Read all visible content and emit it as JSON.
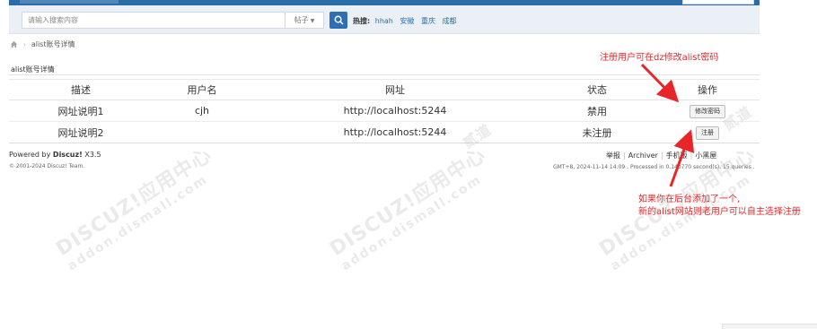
{
  "search": {
    "placeholder": "请输入搜索内容",
    "type_label": "帖子",
    "hot_label": "热搜:",
    "hot_terms": [
      "hhah",
      "安徽",
      "重庆",
      "成都"
    ]
  },
  "breadcrumb": {
    "current": "alist账号详情"
  },
  "section": {
    "title": "alist账号详情"
  },
  "table": {
    "headers": [
      "描述",
      "用户名",
      "网址",
      "状态",
      "操作"
    ],
    "rows": [
      {
        "desc": "网址说明1",
        "username": "cjh",
        "url": "http://localhost:5244",
        "status": "禁用",
        "action": "修改密码"
      },
      {
        "desc": "网址说明2",
        "username": "",
        "url": "http://localhost:5244",
        "status": "未注册",
        "action": "注册"
      }
    ]
  },
  "footer": {
    "powered_prefix": "Powered by",
    "powered_brand": "Discuz!",
    "powered_version": "X3.5",
    "copyright": "© 2001-2024 Discuz! Team.",
    "links": [
      "举报",
      "Archiver",
      "手机版",
      "小黑屋"
    ],
    "gmt": "GMT+8, 2024-11-14 14:09 , Processed in 0.140770 second(s), 15 queries ."
  },
  "watermarks": {
    "brand": "DISCUZ!应用中心",
    "domain": "addon.dismall.com",
    "mark": "贰道"
  },
  "annotations": {
    "note_top": "注册用户可在dz修改alist密码",
    "note_bottom_line1": "如果你在后台添加了一个,",
    "note_bottom_line2": "新的alist网站则老用户可以自主选择注册",
    "color": "#e8262a"
  },
  "colors": {
    "nav_blue": "#2b6ea7",
    "search_bg": "#eaf0f6",
    "search_button": "#2f6db5"
  }
}
